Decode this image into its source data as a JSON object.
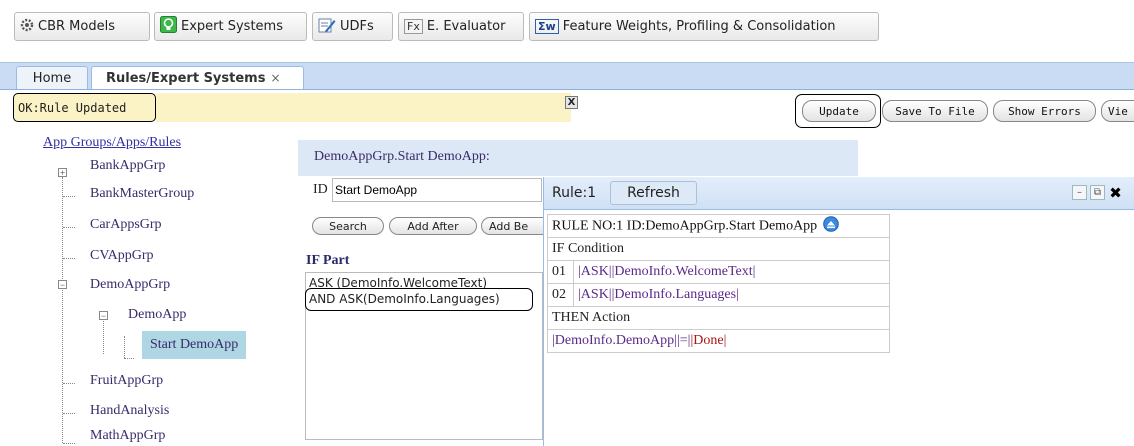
{
  "toolbar": {
    "buttons": [
      {
        "label": "CBR Models",
        "icon": "gear-icon"
      },
      {
        "label": "Expert Systems",
        "icon": "expert-icon"
      },
      {
        "label": "UDFs",
        "icon": "pencil-icon"
      },
      {
        "label": "E. Evaluator",
        "icon": "fx-icon",
        "icon_text": "Fx"
      },
      {
        "label": "Feature Weights, Profiling & Consolidation",
        "icon": "sigma-w-icon",
        "icon_text": "Σw"
      }
    ]
  },
  "tabs": {
    "home": "Home",
    "rules": "Rules/Expert Systems",
    "rules_close": "×"
  },
  "status": {
    "message": "OK:Rule Updated",
    "close": "X"
  },
  "actions": {
    "update": "Update",
    "save_to_file": "Save To File",
    "show_errors": "Show Errors",
    "view": "Vie"
  },
  "tree": {
    "root": "App Groups/Apps/Rules",
    "nodes": {
      "bankappgrp": "BankAppGrp",
      "bankmastergroup": "BankMasterGroup",
      "carappsgrp": "CarAppsGrp",
      "cvappgrp": "CVAppGrp",
      "demoappgrp": "DemoAppGrp",
      "demoapp": "DemoApp",
      "startdemoapp": "Start DemoApp",
      "fruitappgrp": "FruitAppGrp",
      "handanalysis": "HandAnalysis",
      "mathappgrp": "MathAppGrp"
    }
  },
  "editor": {
    "title": "DemoAppGrp.Start DemoApp:",
    "id_label": "ID",
    "id_value": "Start DemoApp",
    "search": "Search",
    "add_after": "Add After",
    "add_before": "Add Be",
    "if_part_label": "IF Part",
    "if_lines": [
      "ASK (DemoInfo.WelcomeText)",
      "AND ASK(DemoInfo.Languages)"
    ]
  },
  "rule_window": {
    "title": "Rule:1",
    "refresh": "Refresh",
    "header": "RULE NO:1 ID:DemoAppGrp.Start DemoApp",
    "if_condition": "IF Condition",
    "conditions": [
      {
        "num": "01",
        "text": "|ASK||DemoInfo.WelcomeText|"
      },
      {
        "num": "02",
        "text": "|ASK||DemoInfo.Languages|"
      }
    ],
    "then_action": "THEN Action",
    "action": {
      "target": "|DemoInfo.DemoApp|",
      "op": "|=|",
      "value": "|Done|"
    }
  },
  "colors": {
    "tab_bar": "#c9dcf3",
    "status_bg": "#fbf3c6",
    "selected_node": "#aed6e3",
    "tree_text": "#3a2a6a",
    "action_value": "#a01818"
  }
}
